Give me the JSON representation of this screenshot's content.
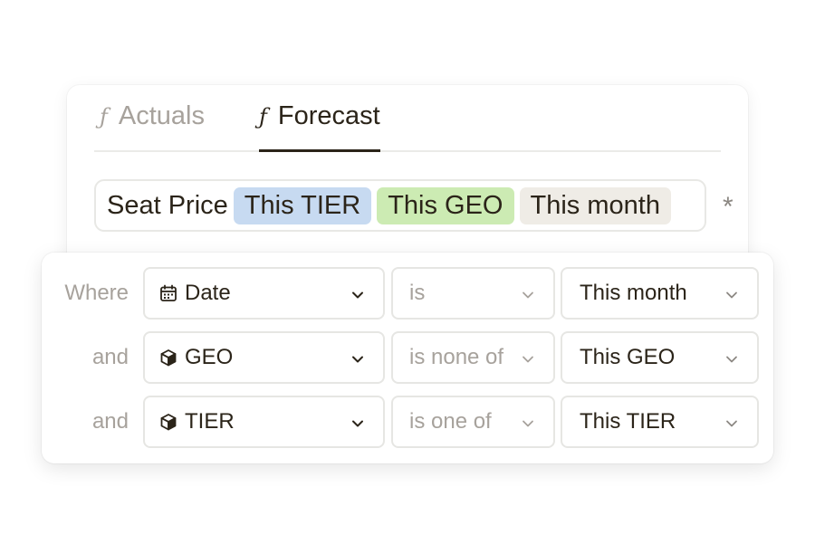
{
  "tabs": [
    {
      "label": "Actuals",
      "icon": "function-icon",
      "active": false
    },
    {
      "label": "Forecast",
      "icon": "function-icon",
      "active": true
    }
  ],
  "formula": {
    "metric": "Seat Price",
    "chips": [
      {
        "label": "This TIER",
        "color": "#c7daf1"
      },
      {
        "label": "This GEO",
        "color": "#ccebb3"
      },
      {
        "label": "This month",
        "color": "#efece6"
      }
    ],
    "operator_symbol": "*"
  },
  "filters": [
    {
      "connector": "Where",
      "field": "Date",
      "field_icon": "calendar-icon",
      "operator": "is",
      "value": "This month"
    },
    {
      "connector": "and",
      "field": "GEO",
      "field_icon": "cube-icon",
      "operator": "is none of",
      "value": "This GEO"
    },
    {
      "connector": "and",
      "field": "TIER",
      "field_icon": "cube-icon",
      "operator": "is one of",
      "value": "This TIER"
    }
  ]
}
